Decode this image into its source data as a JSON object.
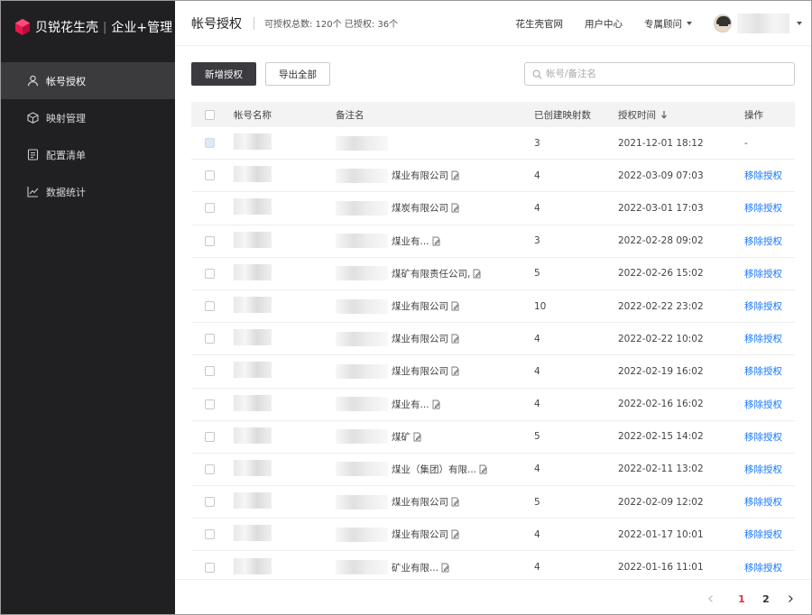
{
  "brand": {
    "name": "贝锐花生壳",
    "product": "企业+管理",
    "logo_color": "#e8174f"
  },
  "sidebar": {
    "items": [
      {
        "label": "帐号授权",
        "icon": "user-icon",
        "active": true
      },
      {
        "label": "映射管理",
        "icon": "cube-icon",
        "active": false
      },
      {
        "label": "配置清单",
        "icon": "list-doc-icon",
        "active": false
      },
      {
        "label": "数据统计",
        "icon": "line-chart-icon",
        "active": false
      }
    ]
  },
  "header": {
    "title": "帐号授权",
    "summary": "可授权总数: 120个 已授权: 36个",
    "links": {
      "official_site": "花生壳官网",
      "user_center": "用户中心",
      "consultant": "专属顾问"
    }
  },
  "toolbar": {
    "add_label": "新增授权",
    "export_label": "导出全部",
    "search_placeholder": "帐号/备注名"
  },
  "table": {
    "columns": {
      "name": "帐号名称",
      "note": "备注名",
      "count": "已创建映射数",
      "time": "授权时间",
      "op": "操作"
    },
    "rows": [
      {
        "note": "",
        "count": "3",
        "time": "2021-12-01 18:12",
        "op": "-"
      },
      {
        "note": "煤业有限公司",
        "count": "4",
        "time": "2022-03-09 07:03",
        "op": "移除授权"
      },
      {
        "note": "煤炭有限公司",
        "count": "4",
        "time": "2022-03-01 17:03",
        "op": "移除授权"
      },
      {
        "note": "煤业有...",
        "count": "3",
        "time": "2022-02-28 09:02",
        "op": "移除授权"
      },
      {
        "note": "煤矿有限责任公司,",
        "count": "5",
        "time": "2022-02-26 15:02",
        "op": "移除授权"
      },
      {
        "note": "煤业有限公司",
        "count": "10",
        "time": "2022-02-22 23:02",
        "op": "移除授权"
      },
      {
        "note": "煤业有限公司",
        "count": "4",
        "time": "2022-02-22 10:02",
        "op": "移除授权"
      },
      {
        "note": "煤业有限公司",
        "count": "4",
        "time": "2022-02-19 16:02",
        "op": "移除授权"
      },
      {
        "note": "煤业有...",
        "count": "4",
        "time": "2022-02-16 16:02",
        "op": "移除授权"
      },
      {
        "note": "煤矿",
        "count": "5",
        "time": "2022-02-15 14:02",
        "op": "移除授权"
      },
      {
        "note": "煤业（集团）有限...",
        "count": "4",
        "time": "2022-02-11 13:02",
        "op": "移除授权"
      },
      {
        "note": "煤业有限公司",
        "count": "5",
        "time": "2022-02-09 12:02",
        "op": "移除授权"
      },
      {
        "note": "煤业有限公司",
        "count": "4",
        "time": "2022-01-17 10:01",
        "op": "移除授权"
      },
      {
        "note": "矿业有限...",
        "count": "4",
        "time": "2022-01-16 11:01",
        "op": "移除授权"
      }
    ]
  },
  "pagination": {
    "pages": [
      "1",
      "2"
    ],
    "current": "1"
  },
  "colors": {
    "sidebar_bg": "#202022",
    "active_nav_bg": "#3b3b3e",
    "primary_button": "#3a3a3f",
    "link": "#1677ff",
    "current_page": "#e0323c"
  }
}
